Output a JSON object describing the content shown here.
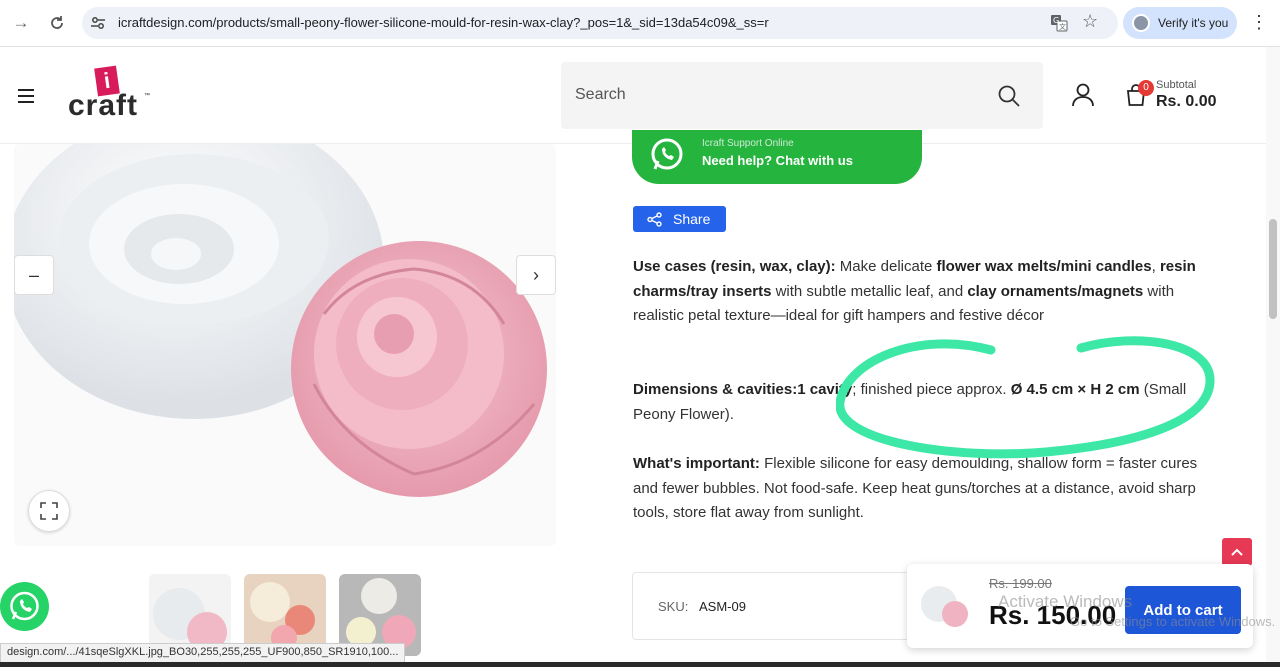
{
  "browser": {
    "url": "icraftdesign.com/products/small-peony-flower-silicone-mould-for-resin-wax-clay?_pos=1&_sid=13da54c09&_ss=r",
    "profile_label": "Verify it's you",
    "status_url": "design.com/.../41sqeSlgXKL.jpg_BO30,255,255,255_UF900,850_SR1910,100...",
    "icons": [
      "back-icon",
      "reload-icon",
      "tune-icon",
      "translate-icon",
      "star-icon",
      "menu-icon"
    ]
  },
  "header": {
    "logo_letter": "i",
    "logo_text": "craft",
    "logo_tm": "™",
    "search_placeholder": "Search",
    "cart_count": "0",
    "subtotal_label": "Subtotal",
    "subtotal_value": "Rs. 0.00"
  },
  "whatsapp": {
    "small": "Icraft Support Online",
    "label": "Need help? Chat with us"
  },
  "share_label": "Share",
  "description": {
    "use_cases_label": "Use cases (resin, wax, clay):",
    "use_cases_t1": " Make delicate ",
    "use_cases_b1": "flower wax melts/mini candles",
    "use_cases_t2": ", ",
    "use_cases_b2": "resin charms/tray inserts",
    "use_cases_t3": " with subtle metallic leaf, and ",
    "use_cases_b3": "clay ornaments/magnets",
    "use_cases_t4": " with realistic petal texture—ideal for gift hampers and festive décor",
    "dims_label": "Dimensions & cavities:",
    "dims_b1": "1 cavity",
    "dims_t1": "; finished piece approx. ",
    "dims_b2": "Ø 4.5 cm × H 2 cm",
    "dims_t2": " (Small Peony Flower).",
    "important_label": "What's important:",
    "important_text": " Flexible silicone for easy demoulding, shallow form = faster cures and fewer bubbles. Not food-safe. Keep heat guns/torches at a distance, avoid sharp tools, store flat away from sunlight."
  },
  "sku": {
    "label": "SKU:",
    "value": "ASM-09"
  },
  "sticky_cart": {
    "old_price": "Rs. 199.00",
    "new_price": "Rs. 150.00",
    "button": "Add to cart"
  },
  "watermark": {
    "line1": "Activate Windows",
    "line2": "Go to Settings to activate Windows."
  },
  "colors": {
    "whatsapp": "#25b53f",
    "accent_blue": "#2563eb",
    "annotation": "#3de8a6",
    "brand_pink": "#d81b5b"
  }
}
